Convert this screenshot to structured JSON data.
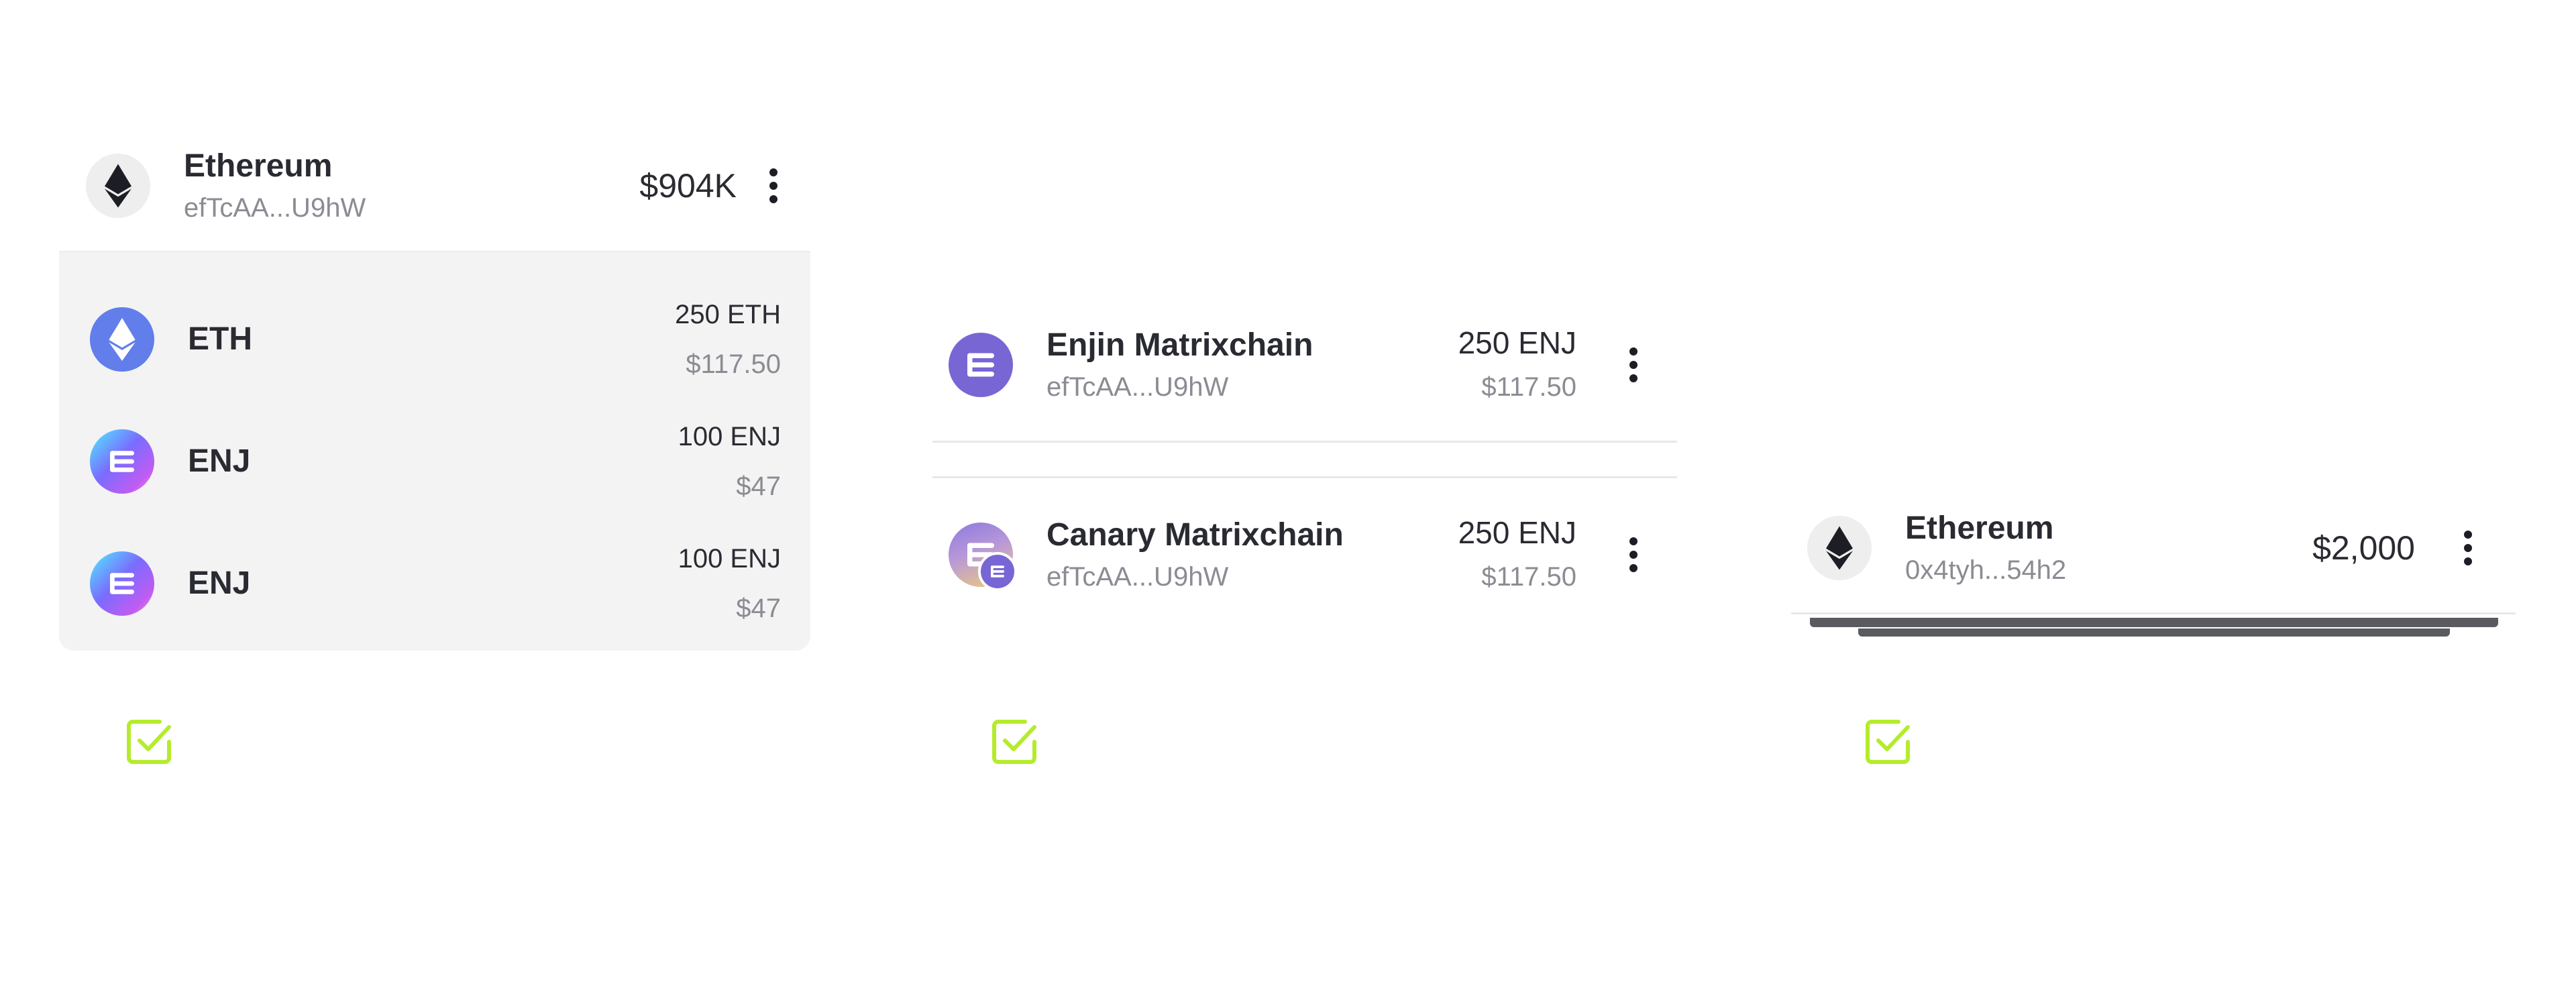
{
  "panel1": {
    "header": {
      "name": "Ethereum",
      "address": "efTcAA...U9hW",
      "value": "$904K",
      "icon": "ethereum-icon"
    },
    "assets": [
      {
        "symbol": "ETH",
        "amount": "250 ETH",
        "fiat": "$117.50",
        "icon": "eth-icon"
      },
      {
        "symbol": "ENJ",
        "amount": "100 ENJ",
        "fiat": "$47",
        "icon": "enj-icon"
      },
      {
        "symbol": "ENJ",
        "amount": "100 ENJ",
        "fiat": "$47",
        "icon": "enj-icon"
      }
    ]
  },
  "panel2": {
    "cards": [
      {
        "name": "Enjin Matrixchain",
        "address": "efTcAA...U9hW",
        "amount": "250 ENJ",
        "fiat": "$117.50",
        "icon": "enjin-matrixchain-icon"
      },
      {
        "name": "Canary Matrixchain",
        "address": "efTcAA...U9hW",
        "amount": "250 ENJ",
        "fiat": "$117.50",
        "icon": "canary-matrixchain-icon"
      }
    ]
  },
  "panel3": {
    "header": {
      "name": "Ethereum",
      "address": "0x4tyh...54h2",
      "value": "$2,000",
      "icon": "ethereum-icon"
    }
  },
  "colors": {
    "check": "#b4ec2c",
    "eth_blue": "#627eea",
    "enj_purple": "#7866d5"
  }
}
